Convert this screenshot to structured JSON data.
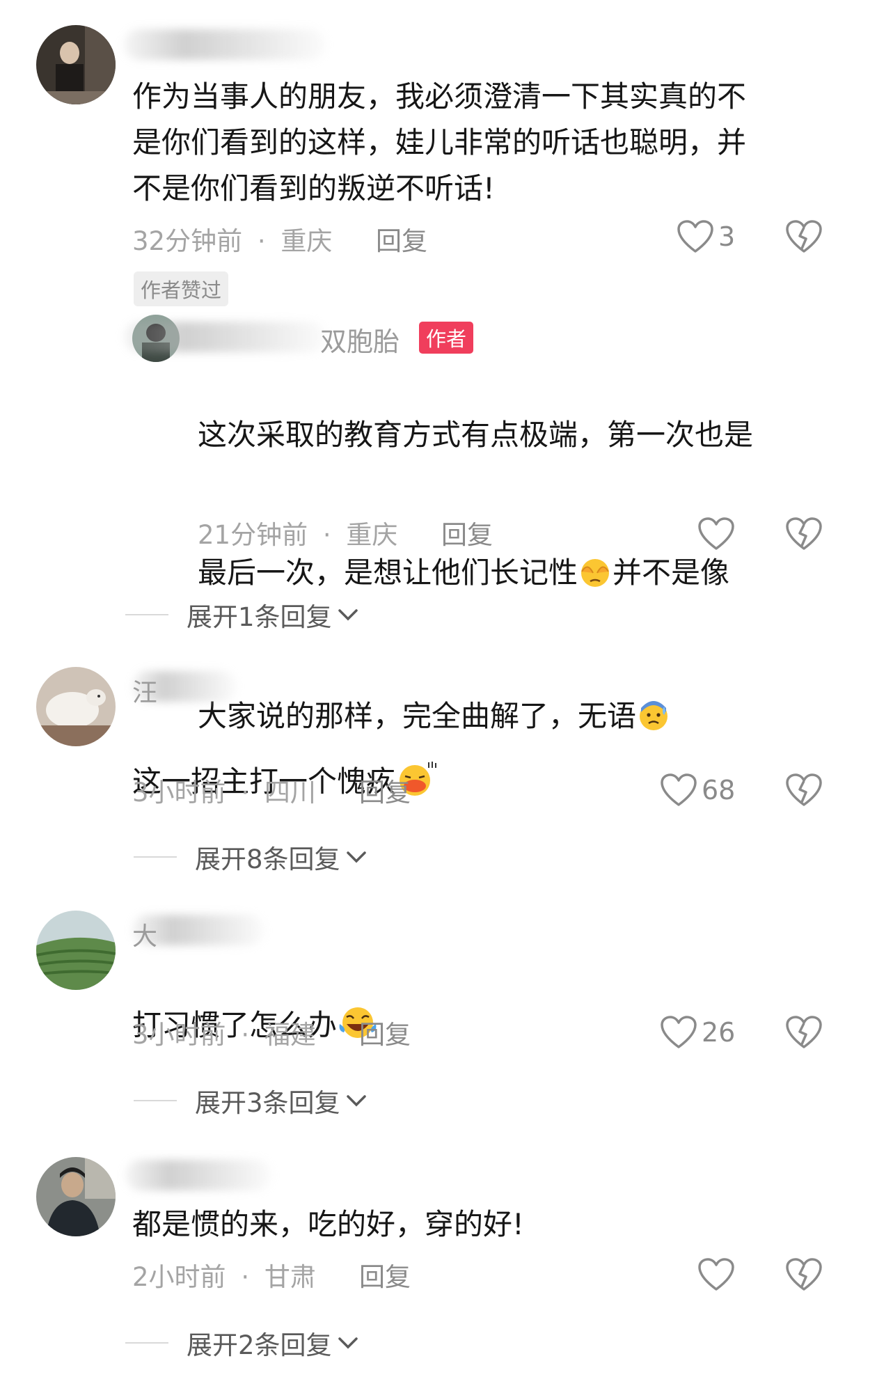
{
  "comments": [
    {
      "name_visible": "",
      "text": "作为当事人的朋友，我必须澄清一下其实真的不\n是你们看到的这样，娃儿非常的听话也聪明，并\n不是你们看到的叛逆不听话!",
      "time": "32分钟前",
      "location": "重庆",
      "reply_label": "回复",
      "likes": "3",
      "liked_tag": "作者赞过",
      "reply": {
        "name_visible": "双胞胎",
        "author_badge": "作者",
        "text_1": "这次采取的教育方式有点极端，第一次也是",
        "text_2a": "最后一次，是想让他们长记性",
        "text_2b": "并不是像",
        "text_3": "大家说的那样，完全曲解了，无语",
        "time": "21分钟前",
        "location": "重庆",
        "reply_label": "回复"
      },
      "expand_label": "展开1条回复"
    },
    {
      "name_visible": "汪",
      "text": "这一招主打一个愧疚",
      "time": "3小时前",
      "location": "四川",
      "reply_label": "回复",
      "likes": "68",
      "expand_label": "展开8条回复"
    },
    {
      "name_visible": "大",
      "text": "打习惯了怎么办",
      "time": "3小时前",
      "location": "福建",
      "reply_label": "回复",
      "likes": "26",
      "expand_label": "展开3条回复"
    },
    {
      "name_visible": "",
      "text": "都是惯的来，吃的好，穿的好!",
      "time": "2小时前",
      "location": "甘肃",
      "reply_label": "回复",
      "likes": "",
      "expand_label": "展开2条回复"
    }
  ],
  "separator": "·",
  "colors": {
    "author_badge": "#f03e5c",
    "meta_text": "#a4a4a4",
    "body_text": "#161616"
  }
}
